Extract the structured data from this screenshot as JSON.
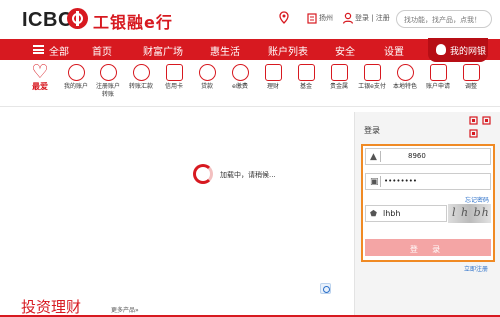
{
  "brand": {
    "logo_text": "ICBC",
    "logo_cn": "工银融e行",
    "accent_color": "#d71920"
  },
  "topbar": {
    "location_icon": "location-pin-icon",
    "location_label": "",
    "city": "扬州",
    "login_register": "登录 | 注册",
    "search_placeholder": "找功能，找产品，点我！"
  },
  "nav": {
    "all": "全部",
    "items": [
      "首页",
      "财富广场",
      "惠生活",
      "账户列表",
      "安全",
      "设置"
    ],
    "mybank": "我的网银"
  },
  "quick_links": {
    "favorite": "最爱",
    "items": [
      {
        "label": "我的账户",
        "icon": "yen-circle-icon"
      },
      {
        "label": "注册账户\n转账",
        "icon": "yen-circle-icon"
      },
      {
        "label": "转账汇款",
        "icon": "yen-circle-icon"
      },
      {
        "label": "信用卡",
        "icon": "card-icon"
      },
      {
        "label": "贷款",
        "icon": "money-bag-icon"
      },
      {
        "label": "e缴费",
        "icon": "drop-icon"
      },
      {
        "label": "理财",
        "icon": "grid-icon"
      },
      {
        "label": "基金",
        "icon": "chart-icon"
      },
      {
        "label": "贵金属",
        "icon": "gold-icon"
      },
      {
        "label": "工银e支付",
        "icon": "pay-icon"
      },
      {
        "label": "本地特色",
        "icon": "local-icon"
      },
      {
        "label": "账户申请",
        "icon": "apply-icon"
      },
      {
        "label": "调整",
        "icon": "adjust-icon"
      }
    ]
  },
  "loading": {
    "text": "加载中，请稍候..."
  },
  "login": {
    "title": "登录",
    "username": "8960",
    "password": "••••••••",
    "forgot": "忘记密码",
    "captcha_value": "lhbh",
    "captcha_image_text": "l h bh",
    "button": "登 录",
    "register": "立即注册"
  },
  "section": {
    "title": "投资理财",
    "more": "更多产品»"
  }
}
